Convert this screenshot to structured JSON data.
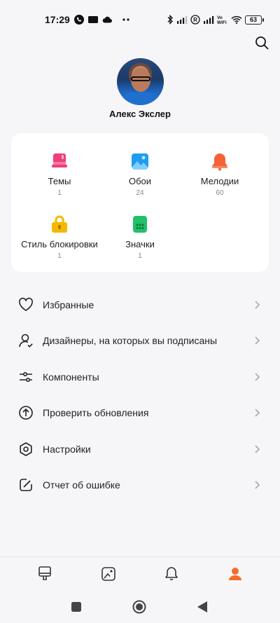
{
  "status_bar": {
    "time": "17:29",
    "wifi_label": "Vo\nWiFi",
    "battery": "63"
  },
  "profile": {
    "name": "Алекс Экслер"
  },
  "categories": [
    {
      "label": "Темы",
      "count": "1",
      "icon": "theme-icon",
      "color": "#ef3f7a"
    },
    {
      "label": "Обои",
      "count": "24",
      "icon": "wallpaper-icon",
      "color": "#1e9cf0"
    },
    {
      "label": "Мелодии",
      "count": "60",
      "icon": "bell-icon",
      "color": "#f5623a"
    },
    {
      "label": "Стиль блокировки",
      "count": "1",
      "icon": "lock-icon",
      "color": "#f5b800"
    },
    {
      "label": "Значки",
      "count": "1",
      "icon": "icons-icon",
      "color": "#22c06a"
    }
  ],
  "menu": [
    {
      "label": "Избранные",
      "icon": "heart-icon"
    },
    {
      "label": "Дизайнеры, на которых вы подписаны",
      "icon": "person-check-icon"
    },
    {
      "label": "Компоненты",
      "icon": "sliders-icon"
    },
    {
      "label": "Проверить обновления",
      "icon": "arrow-up-circle-icon"
    },
    {
      "label": "Настройки",
      "icon": "settings-icon"
    },
    {
      "label": "Отчет об ошибке",
      "icon": "edit-square-icon"
    }
  ],
  "bottom_nav": [
    {
      "icon": "brush-icon",
      "active": false
    },
    {
      "icon": "image-icon",
      "active": false
    },
    {
      "icon": "bell-nav-icon",
      "active": false
    },
    {
      "icon": "profile-icon",
      "active": true
    }
  ],
  "colors": {
    "accent": "#f46d2a",
    "text": "#222222",
    "muted": "#888888",
    "background": "#f6f6f8"
  }
}
